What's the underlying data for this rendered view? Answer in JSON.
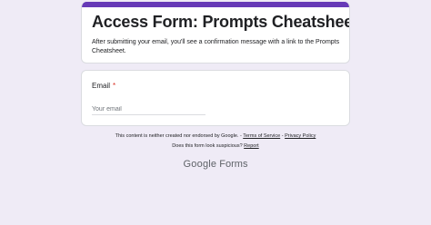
{
  "colors": {
    "accent": "#673ab7",
    "background": "#efebf6",
    "required": "#d93025"
  },
  "header": {
    "title": "Access Form: Prompts Cheatsheet",
    "description": "After submitting your email, you'll see a confirmation message with a link to the Prompts Cheatsheet."
  },
  "question": {
    "label": "Email",
    "required_mark": "*",
    "placeholder": "Your email"
  },
  "footer": {
    "disclaimer_text": "This content is neither created nor endorsed by Google. -",
    "terms_link": "Terms of Service",
    "separator": "-",
    "privacy_link": "Privacy Policy",
    "suspicious_text": "Does this form look suspicious?",
    "report_link": "Report"
  },
  "brand": {
    "google": "Google",
    "forms": "Forms"
  }
}
